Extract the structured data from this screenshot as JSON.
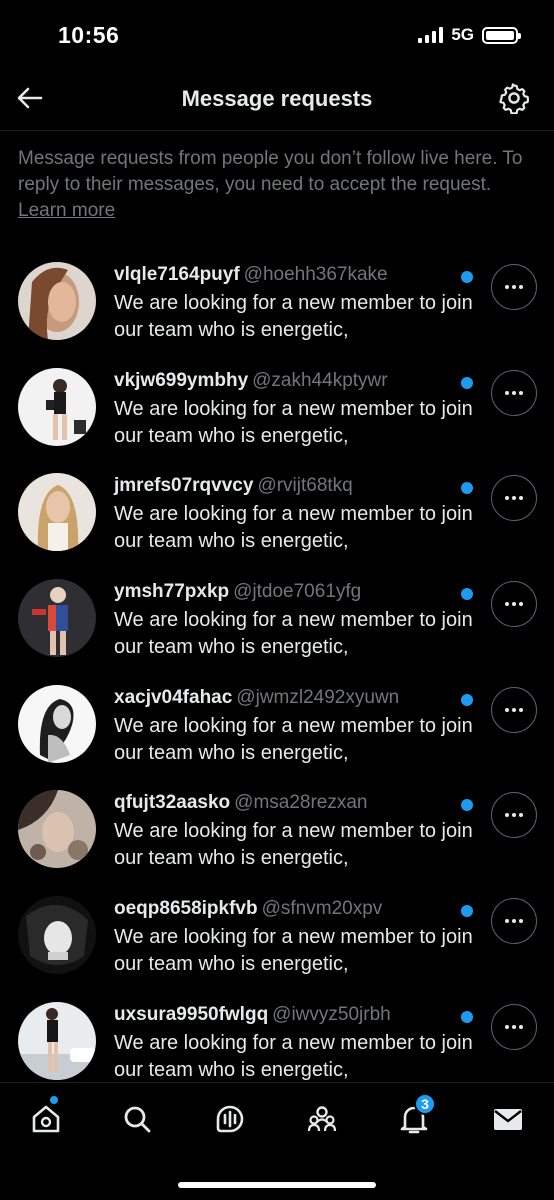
{
  "status_bar": {
    "time": "10:56",
    "network": "5G"
  },
  "header": {
    "title": "Message requests",
    "back_icon": "arrow-left-icon",
    "settings_icon": "gear-icon"
  },
  "info": {
    "text": "Message requests from people you don’t follow live here. To reply to their messages, you need to accept the request.",
    "link": "Learn more"
  },
  "requests": [
    {
      "name": "vlqle7164puyf",
      "handle": "@hoehh367kake",
      "message": "We are looking for a new member to join our team who is energetic,"
    },
    {
      "name": "vkjw699ymbhy",
      "handle": "@zakh44kptywr",
      "message": "We are looking for a new member to join our team who is energetic,"
    },
    {
      "name": "jmrefs07rqvvcy",
      "handle": "@rvijt68tkq",
      "message": "We are looking for a new member to join our team who is energetic,"
    },
    {
      "name": "ymsh77pxkp",
      "handle": "@jtdoe7061yfg",
      "message": "We are looking for a new member to join our team who is energetic,"
    },
    {
      "name": "xacjv04fahac",
      "handle": "@jwmzl2492xyuwn",
      "message": "We are looking for a new member to join our team who is energetic,"
    },
    {
      "name": "qfujt32aasko",
      "handle": "@msa28rezxan",
      "message": "We are looking for a new member to join our team who is energetic,"
    },
    {
      "name": "oeqp8658ipkfvb",
      "handle": "@sfnvm20xpv",
      "message": "We are looking for a new member to join our team who is energetic,"
    },
    {
      "name": "uxsura9950fwlgq",
      "handle": "@iwvyz50jrbh",
      "message": "We are looking for a new member to join our team who is energetic,"
    }
  ],
  "tabbar": {
    "items": [
      "home-icon",
      "search-icon",
      "spaces-icon",
      "communities-icon",
      "bell-icon",
      "mail-icon"
    ],
    "notification_count": "3"
  },
  "colors": {
    "accent": "#1d9bf0",
    "muted": "#71767b",
    "text": "#e7e9ea",
    "background": "#000000"
  }
}
